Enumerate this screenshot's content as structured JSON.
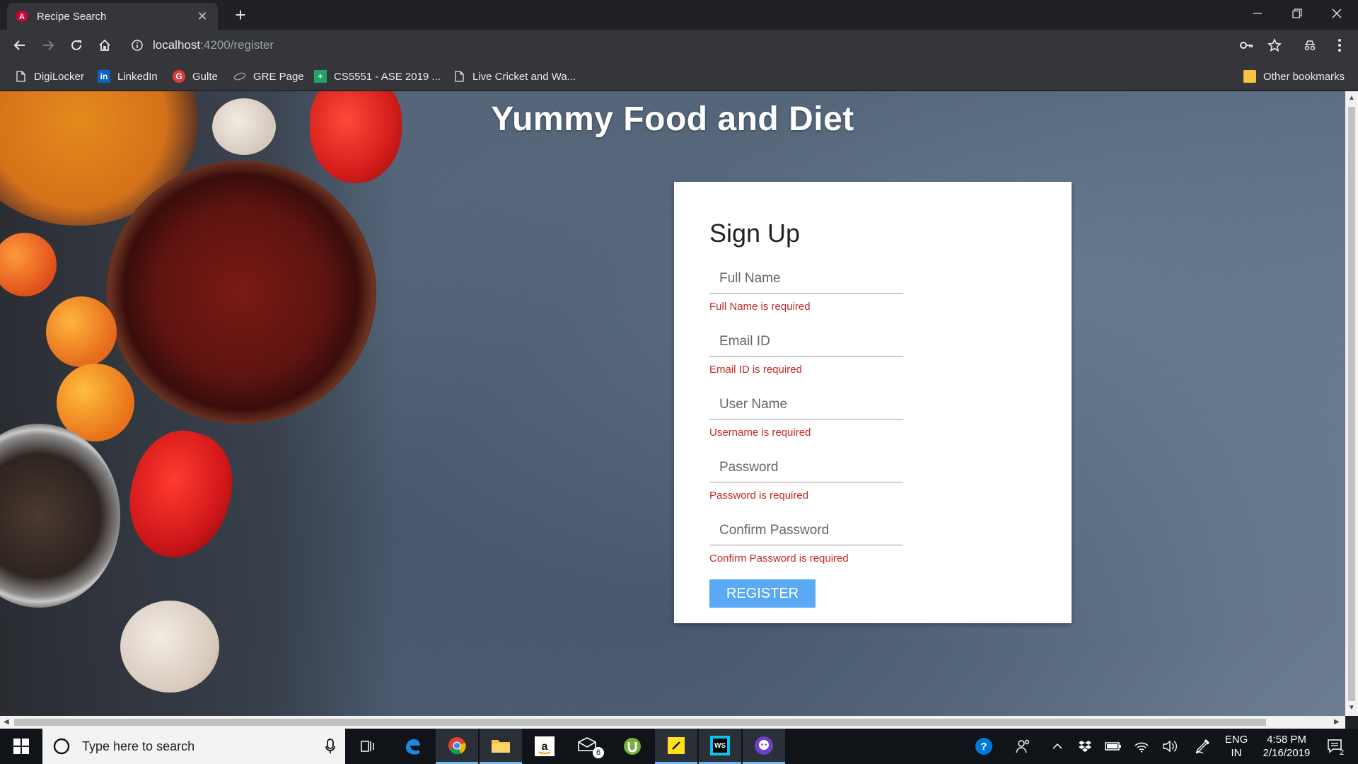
{
  "browser": {
    "tab": {
      "title": "Recipe Search"
    },
    "url": {
      "host": "localhost",
      "path": ":4200/register"
    },
    "bookmarks": [
      {
        "label": "DigiLocker",
        "icon": "page-icon"
      },
      {
        "label": "LinkedIn",
        "icon": "linkedin-icon"
      },
      {
        "label": "Gulte",
        "icon": "gulte-icon"
      },
      {
        "label": "GRE Page",
        "icon": "gre-icon"
      },
      {
        "label": "CS5551 - ASE 2019 ...",
        "icon": "sheets-icon"
      },
      {
        "label": "Live Cricket and Wa...",
        "icon": "page-icon"
      }
    ],
    "other_bookmarks": "Other bookmarks"
  },
  "page": {
    "title": "Yummy Food and Diet"
  },
  "form": {
    "heading": "Sign Up",
    "fields": [
      {
        "placeholder": "Full Name",
        "error": "Full Name is required"
      },
      {
        "placeholder": "Email ID",
        "error": "Email ID is required"
      },
      {
        "placeholder": "User Name",
        "error": "Username is required"
      },
      {
        "placeholder": "Password",
        "error": "Password is required"
      },
      {
        "placeholder": "Confirm Password",
        "error": "Confirm Password is required"
      }
    ],
    "submit_label": "REGISTER"
  },
  "taskbar": {
    "search_placeholder": "Type here to search",
    "mail_badge": "6",
    "lang_line1": "ENG",
    "lang_line2": "IN",
    "time": "4:58 PM",
    "date": "2/16/2019",
    "notifications": "2"
  },
  "colors": {
    "error": "#c62828",
    "button": "#5aa9f5",
    "tab_bg": "#35363a",
    "taskbar": "#101318"
  }
}
